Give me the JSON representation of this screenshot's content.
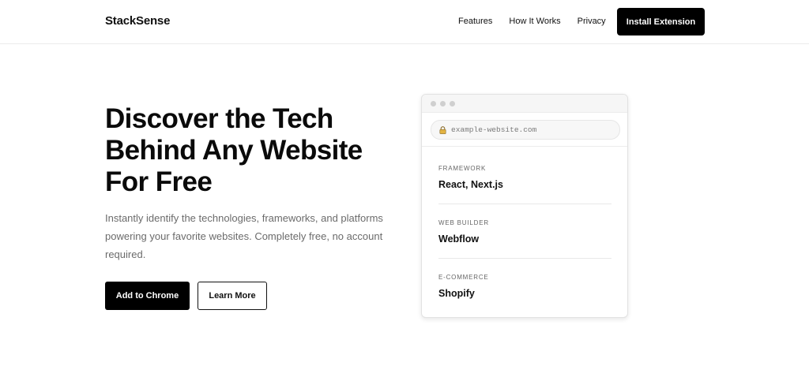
{
  "header": {
    "brand": "StackSense",
    "nav": [
      "Features",
      "How It Works",
      "Privacy"
    ],
    "install_label": "Install Extension"
  },
  "hero": {
    "title_lines": [
      "Discover the Tech",
      "Behind Any Website",
      "For Free"
    ],
    "subtitle": "Instantly identify the technologies, frameworks, and platforms powering your favorite websites. Completely free, no account required.",
    "primary_cta": "Add to Chrome",
    "secondary_cta": "Learn More"
  },
  "mockup": {
    "url": "example-website.com",
    "url_icon": "lock-icon",
    "items": [
      {
        "label": "FRAMEWORK",
        "value": "React, Next.js"
      },
      {
        "label": "WEB BUILDER",
        "value": "Webflow"
      },
      {
        "label": "E-COMMERCE",
        "value": "Shopify"
      }
    ]
  },
  "colors": {
    "primary": "#000000",
    "text": "#111111",
    "muted": "#6b6b6b",
    "border": "#ececec"
  }
}
